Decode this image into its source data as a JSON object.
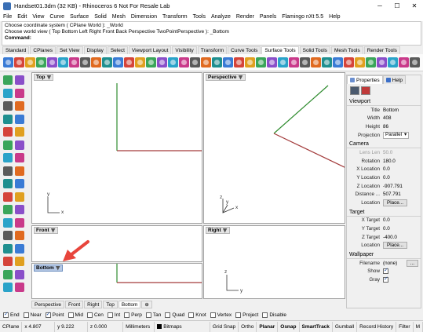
{
  "window": {
    "title": "Handset01.3dm (32 KB) - Rhinoceros 6 Not For Resale Lab"
  },
  "menu": [
    "File",
    "Edit",
    "View",
    "Curve",
    "Surface",
    "Solid",
    "Mesh",
    "Dimension",
    "Transform",
    "Tools",
    "Analyze",
    "Render",
    "Panels",
    "Flamingo nXt 5.5",
    "Help"
  ],
  "command": {
    "line1": "Choose coordinate system ( CPlane  World ): _World",
    "line2": "Choose world view ( Top  Bottom  Left  Right  Front  Back  Perspective  TwoPointPerspective ): _Bottom",
    "prompt": "Command:"
  },
  "toolbar_tabs": [
    "Standard",
    "CPlanes",
    "Set View",
    "Display",
    "Select",
    "Viewport Layout",
    "Visibility",
    "Transform",
    "Curve Tools",
    "Surface Tools",
    "Solid Tools",
    "Mesh Tools",
    "Render Tools"
  ],
  "toolbar_active_tab": "Surface Tools",
  "viewports": {
    "top": "Top",
    "perspective": "Perspective",
    "front": "Front",
    "right": "Right",
    "bottom": "Bottom"
  },
  "axis": {
    "x": "x",
    "y": "y",
    "z": "z"
  },
  "viewport_tabs": [
    "Perspective",
    "Front",
    "Right",
    "Top",
    "Bottom"
  ],
  "viewport_tab_active": "Bottom",
  "osnap": [
    {
      "label": "End",
      "on": true
    },
    {
      "label": "Near",
      "on": false
    },
    {
      "label": "Point",
      "on": true
    },
    {
      "label": "Mid",
      "on": false
    },
    {
      "label": "Cen",
      "on": false
    },
    {
      "label": "Int",
      "on": false
    },
    {
      "label": "Perp",
      "on": false
    },
    {
      "label": "Tan",
      "on": false
    },
    {
      "label": "Quad",
      "on": false
    },
    {
      "label": "Knot",
      "on": false
    },
    {
      "label": "Vertex",
      "on": false
    },
    {
      "label": "Project",
      "on": false
    },
    {
      "label": "Disable",
      "on": false
    }
  ],
  "status": {
    "cplane": "CPlane",
    "x": "x 4.807",
    "y": "y 9.222",
    "z": "z 0.000",
    "units": "Millimeters",
    "layer": "Bitmaps",
    "toggles": [
      "Grid Snap",
      "Ortho",
      "Planar",
      "Osnap",
      "SmartTrack",
      "Gumball",
      "Record History",
      "Filter",
      "M"
    ]
  },
  "properties": {
    "tabs": [
      "Properties",
      "Help"
    ],
    "viewport_section": "Viewport",
    "title_label": "Title",
    "title_value": "Bottom",
    "width_label": "Width",
    "width_value": "408",
    "height_label": "Height",
    "height_value": "86",
    "projection_label": "Projection",
    "projection_value": "Parallel",
    "camera_section": "Camera",
    "lens_label": "Lens Len",
    "lens_value": "50.0",
    "rotation_label": "Rotation",
    "rotation_value": "180.0",
    "xloc_label": "X Location",
    "xloc_value": "0.0",
    "yloc_label": "Y Location",
    "yloc_value": "0.0",
    "zloc_label": "Z Location",
    "zloc_value": "-907.791",
    "distance_label": "Distance ...",
    "distance_value": "507.791",
    "location_label": "Location",
    "place_label": "Place...",
    "target_section": "Target",
    "xt_label": "X Target",
    "xt_value": "0.0",
    "yt_label": "Y Target",
    "yt_value": "0.0",
    "zt_label": "Z Target",
    "zt_value": "-400.0",
    "wallpaper_section": "Wallpaper",
    "filename_label": "Filename",
    "filename_value": "(none)",
    "show_label": "Show",
    "gray_label": "Gray"
  },
  "colors": {
    "x_axis": "#a33b3b",
    "y_axis": "#2e8b2e",
    "annotation_arrow": "#e8453c"
  }
}
